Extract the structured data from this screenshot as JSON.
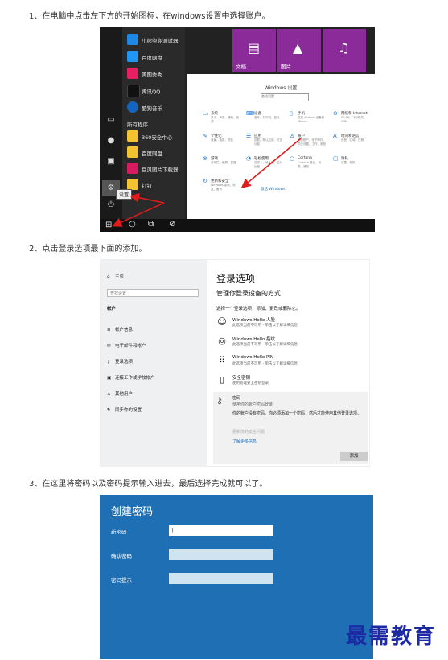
{
  "steps": [
    "1、在电脑中点击左下方的开始图标，在windows设置中选择账户。",
    "2、点击登录选项最下面的添加。",
    "3、在这里将密码以及密码提示输入进去，最后选择完成就可以了。"
  ],
  "start_menu": {
    "apps": [
      "小熊兜兜测试器",
      "百度网盘",
      "美图秀秀",
      "腾讯QQ",
      "酷狗音乐"
    ],
    "section": "所有程序",
    "apps2": [
      "360安全中心",
      "百度网盘",
      "豆贝图片下载器",
      "钉钉"
    ],
    "tiles": [
      "文档",
      "图片",
      ""
    ],
    "tooltip": "设置"
  },
  "windows_settings": {
    "title": "Windows 设置",
    "search_placeholder": "查找设置",
    "items": [
      {
        "label": "系统",
        "desc": "显示、声音、通知、电源"
      },
      {
        "label": "设备",
        "desc": "蓝牙、打印机、鼠标"
      },
      {
        "label": "手机",
        "desc": "连接 Android 设备和 iPhone"
      },
      {
        "label": "网络和 Internet",
        "desc": "WLAN、飞行模式、VPN"
      },
      {
        "label": "个性化",
        "desc": "背景、锁屏、颜色"
      },
      {
        "label": "应用",
        "desc": "卸载、默认应用、可选功能"
      },
      {
        "label": "账户",
        "desc": "你的账户、电子邮件、同步设置、工作、家庭"
      },
      {
        "label": "时间和语言",
        "desc": "语音、区域、日期"
      },
      {
        "label": "游戏",
        "desc": "游戏栏、截屏、直播"
      },
      {
        "label": "轻松使用",
        "desc": "讲述人、放大镜、高对比度"
      },
      {
        "label": "Cortana",
        "desc": "Cortana 语言、权限、通知"
      },
      {
        "label": "隐私",
        "desc": "位置、相机"
      },
      {
        "label": "更新和安全",
        "desc": "Windows 更新、恢复、备份"
      }
    ],
    "link": "激活 Windows"
  },
  "signin_options": {
    "home": "主页",
    "search_placeholder": "查找设置",
    "section": "帐户",
    "nav": [
      "帐户信息",
      "电子邮件和帐户",
      "登录选项",
      "连接工作或学校帐户",
      "其他用户",
      "同步你的设置"
    ],
    "title": "登录选项",
    "subtitle": "管理你登录设备的方式",
    "choose": "选择一个登录选项，添加、更改或删除它。",
    "options": [
      {
        "name": "Windows Hello 人脸",
        "desc": "此选项当前不可用 - 单击以了解详细信息"
      },
      {
        "name": "Windows Hello 指纹",
        "desc": "此选项当前不可用 - 单击以了解详细信息"
      },
      {
        "name": "Windows Hello PIN",
        "desc": "此选项当前不可用 - 单击以了解详细信息"
      },
      {
        "name": "安全密钥",
        "desc": "使用物理安全密钥登录"
      },
      {
        "name": "密码",
        "desc": "使用你的帐户密码登录"
      }
    ],
    "password_note": "你的帐户没有密码。你必须添加一个密码，然后才能使用其他登录选项。",
    "learn_link": "了解更多信息",
    "gray_text": "更新你的安全问题",
    "add_button": "添加"
  },
  "create_password": {
    "title": "创建密码",
    "fields": [
      {
        "label": "新密码",
        "value": "|"
      },
      {
        "label": "确认密码",
        "value": ""
      },
      {
        "label": "密码提示",
        "value": ""
      }
    ]
  },
  "watermark": "最需教育",
  "colors": {
    "settings_blue": "#1f6fb5",
    "arrow_red": "#e21b1b",
    "tile_purple": "#8a2b99"
  }
}
